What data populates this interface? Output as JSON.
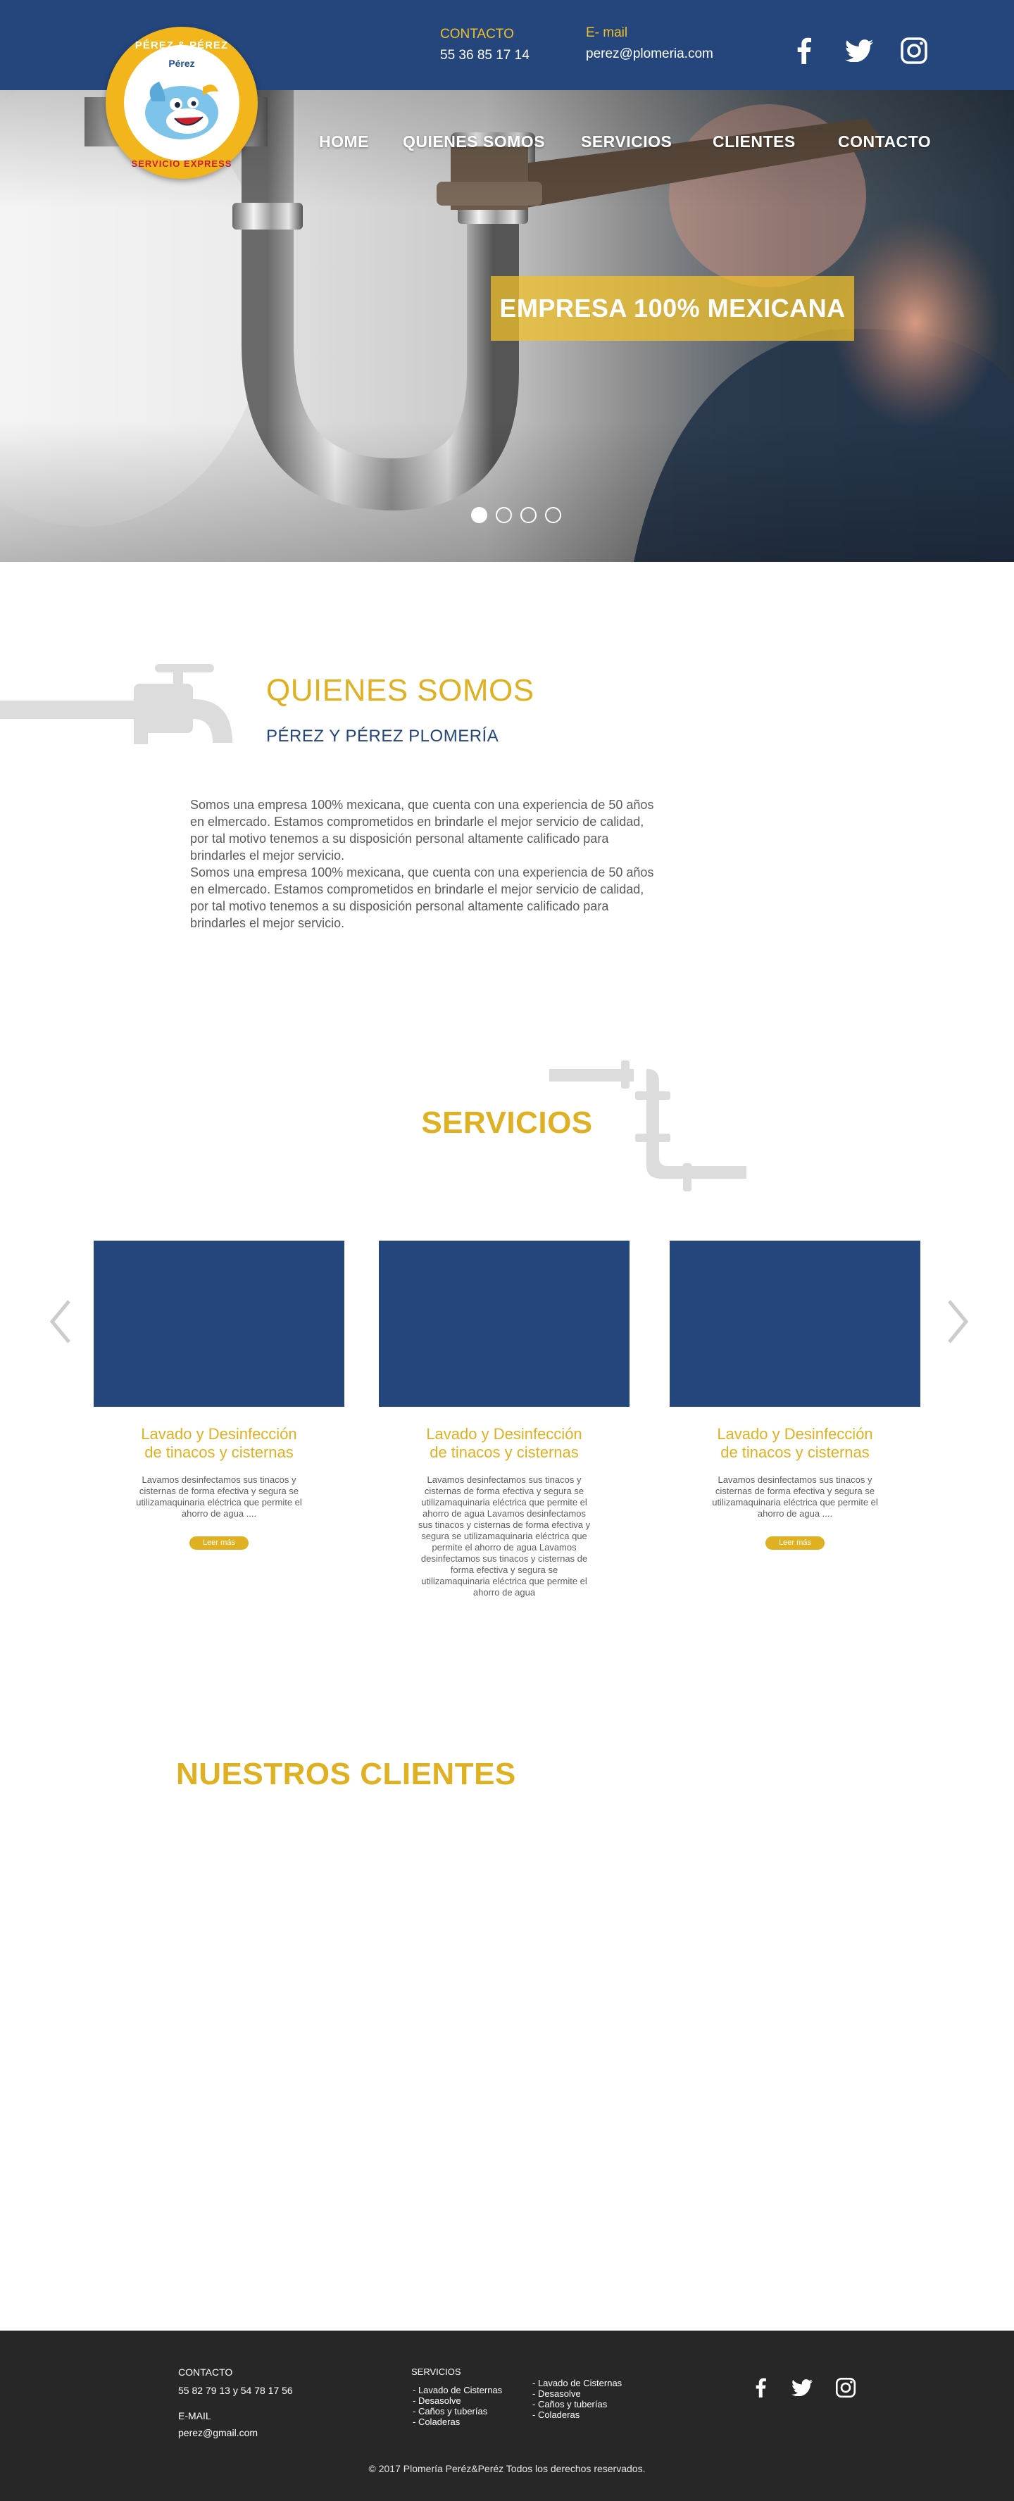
{
  "header": {
    "phone_label": "CONTACTO",
    "phone": "55 36 85 17 14",
    "email_label": "E- mail",
    "email": "perez@plomeria.com",
    "logo_top": "PÉREZ & PÉREZ",
    "logo_name": "Pérez",
    "logo_bottom": "SERVICIO EXPRESS",
    "social": [
      "facebook-icon",
      "twitter-icon",
      "instagram-icon"
    ]
  },
  "nav": {
    "items": [
      "HOME",
      "QUIENES SOMOS",
      "SERVICIOS",
      "CLIENTES",
      "CONTACTO"
    ]
  },
  "hero": {
    "banner": "EMPRESA 100% MEXICANA",
    "slide_count": 4,
    "active_slide": 1
  },
  "about": {
    "title": "QUIENES SOMOS",
    "subtitle": "PÉREZ Y PÉREZ PLOMERÍA",
    "paragraphs": [
      "Somos una empresa 100% mexicana, que cuenta con una experiencia de 50 años en elmercado. Estamos comprometidos en brindarle el mejor servicio de calidad, por tal motivo tenemos a su disposición personal altamente calificado para brindarles el mejor servicio.",
      "Somos una empresa 100% mexicana, que cuenta con una experiencia de 50 años en elmercado. Estamos comprometidos en brindarle el mejor servicio de calidad, por tal motivo tenemos a su disposición personal altamente calificado para brindarles el mejor servicio."
    ]
  },
  "services": {
    "title": "SERVICIOS",
    "cards": [
      {
        "title_line1": "Lavado y Desinfección",
        "title_line2": "de tinacos y cisternas",
        "text": "Lavamos desinfectamos sus tinacos y cisternas de forma efectiva y segura se utilizamaquinaria eléctrica que permite el ahorro de agua ....",
        "button": "Leer más"
      },
      {
        "title_line1": "Lavado y Desinfección",
        "title_line2": "de tinacos y cisternas",
        "text": "Lavamos desinfectamos sus tinacos y cisternas de forma efectiva y segura se utilizamaquinaria eléctrica que permite el ahorro de agua Lavamos desinfectamos sus tinacos y cisternas de forma efectiva y segura se utilizamaquinaria eléctrica que permite el ahorro de agua Lavamos desinfectamos sus tinacos y cisternas de forma efectiva y segura se utilizamaquinaria eléctrica que permite el ahorro de agua",
        "button": ""
      },
      {
        "title_line1": "Lavado y Desinfección",
        "title_line2": "de tinacos y cisternas",
        "text": "Lavamos desinfectamos sus tinacos y cisternas de forma efectiva y segura se utilizamaquinaria eléctrica que permite el ahorro de agua ....",
        "button": "Leer más"
      }
    ]
  },
  "clients": {
    "title": "NUESTROS CLIENTES"
  },
  "footer": {
    "contact_label": "CONTACTO",
    "phones": "55 82 79 13 y 54 78 17 56",
    "email_label": "E-MAIL",
    "email": "perez@gmail.com",
    "services_label": "SERVICIOS",
    "services_col1": [
      "- Lavado de Cisternas",
      "- Desasolve",
      "- Caños y tuberías",
      "- Coladeras"
    ],
    "services_col2": [
      "- Lavado de Cisternas",
      "- Desasolve",
      "- Caños y tuberías",
      "- Coladeras"
    ],
    "copyright": "© 2017 Plomería Peréz&Peréz Todos los derechos reservados."
  },
  "colors": {
    "brand_blue": "#24467d",
    "accent_gold": "#e0b023",
    "footer_bg": "#272727"
  }
}
